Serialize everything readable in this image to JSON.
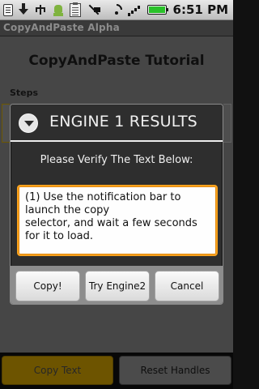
{
  "status_bar": {
    "time": "6:51 PM",
    "icons": [
      "message-icon",
      "download-icon",
      "usb-icon",
      "android-icon",
      "clipboard-icon",
      "muted-icon",
      "wifi-icon",
      "signal-icon",
      "battery-icon"
    ]
  },
  "app": {
    "title": "CopyAndPaste Alpha",
    "heading": "CopyAndPaste Tutorial",
    "steps_label": "Steps"
  },
  "dialog": {
    "title": "ENGINE 1 RESULTS",
    "message": "Please Verify The Text Below:",
    "text_value": "(1) Use the notification bar to\nlaunch the copy\nselector, and wait a few seconds\nfor it to load.",
    "buttons": {
      "copy": "Copy!",
      "engine2": "Try Engine2",
      "cancel": "Cancel"
    }
  },
  "bottom_buttons": {
    "copy_text": "Copy Text",
    "reset_handles": "Reset Handles"
  },
  "colors": {
    "accent_orange": "#f7a11d",
    "dialog_bg": "#2e2e2e",
    "button_bar": "#8d8d8d",
    "copy_text_button": "#7a5e00"
  }
}
